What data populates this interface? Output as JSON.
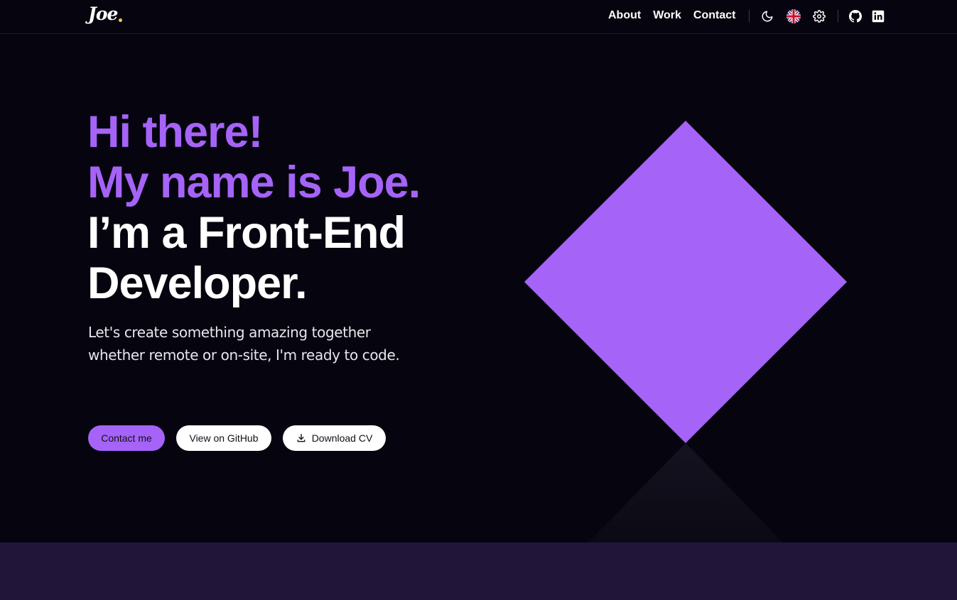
{
  "logo": {
    "text": "Joe"
  },
  "nav": {
    "links": [
      "About",
      "Work",
      "Contact"
    ],
    "icons": [
      "moon-icon",
      "uk-flag-icon",
      "gear-icon",
      "github-icon",
      "linkedin-icon"
    ]
  },
  "hero": {
    "line1": "Hi there!",
    "line2": "My name is Joe.",
    "line3": "I’m a Front-End",
    "line4": "Developer.",
    "subtitle_line1": "Let's create something amazing together",
    "subtitle_line2": "whether remote or on-site, I'm ready to code."
  },
  "buttons": {
    "contact": "Contact me",
    "github": "View on GitHub",
    "cv": "Download CV"
  },
  "colors": {
    "accent": "#a563f7",
    "background": "#06050f",
    "logo_dot": "#f2c94c",
    "bottom_band": "#21163a"
  }
}
